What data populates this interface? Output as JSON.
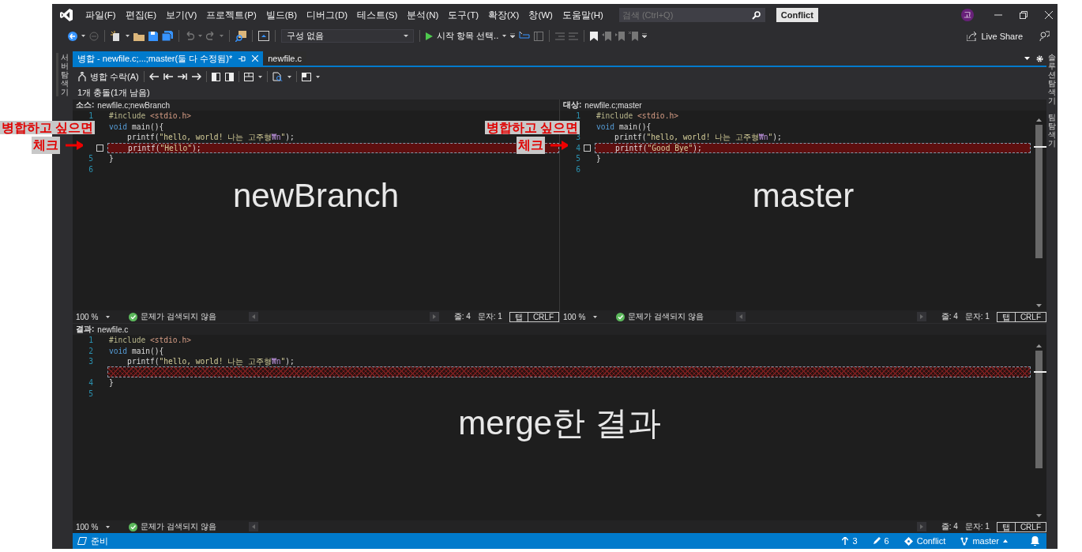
{
  "title_bar": {
    "menu": [
      "파일(F)",
      "편집(E)",
      "보기(V)",
      "프로젝트(P)",
      "빌드(B)",
      "디버그(D)",
      "테스트(S)",
      "분석(N)",
      "도구(T)",
      "확장(X)",
      "창(W)",
      "도움말(H)"
    ],
    "search": {
      "placeholder": "검색 (Ctrl+Q)"
    },
    "solution_badge": "Conflict",
    "avatar": "고"
  },
  "toolbar": {
    "configuration": "구성 없음",
    "start_item": "시작 항목 선택..",
    "live_share": "Live Share"
  },
  "side_tabs_left": [
    "서버 탐색기"
  ],
  "side_tabs_right": [
    "솔루션 탐색기",
    "팀 탐색기"
  ],
  "doc_tabs": [
    {
      "label": "병합 - newfile.c;...;master(둘 다 수정됨)*",
      "selected": true
    },
    {
      "label": "newfile.c",
      "selected": false
    }
  ],
  "merge_toolbar": {
    "accept": "병합 수락(A)"
  },
  "conflict_summary": "1개 충돌(1개 남음)",
  "panes": [
    {
      "label": "소스:",
      "file": "newfile.c;newBranch",
      "overlay_label": "newBranch",
      "scrollbar": false,
      "lines": [
        {
          "kind": "code",
          "number": "1",
          "tokens": [
            {
              "text": "#include ",
              "kind": "preproc"
            },
            {
              "text": "<stdio.h>",
              "kind": "header"
            }
          ]
        },
        {
          "kind": "code",
          "tokens": [
            {
              "text": "void",
              "kind": "keyword"
            },
            {
              "text": " main(){",
              "kind": "plain"
            }
          ]
        },
        {
          "kind": "code",
          "tokens": [
            {
              "text": "    printf(",
              "kind": "plain"
            },
            {
              "text": "\"hello, world! 나는 고주형",
              "kind": "string"
            },
            {
              "text": "₩n",
              "kind": "escape"
            },
            {
              "text": "\"",
              "kind": "string"
            },
            {
              "text": ");",
              "kind": "plain"
            }
          ]
        },
        {
          "kind": "conflict",
          "checked": false,
          "tokens": [
            {
              "text": "    printf(",
              "kind": "plain"
            },
            {
              "text": "\"Hello\"",
              "kind": "string"
            },
            {
              "text": ");",
              "kind": "plain"
            }
          ]
        },
        {
          "kind": "code",
          "number": "5",
          "tokens": [
            {
              "text": "}",
              "kind": "plain"
            }
          ]
        },
        {
          "kind": "code",
          "number": "6"
        }
      ],
      "status": {
        "zoom": "100 %",
        "issues": "문제가 검색되지 않음",
        "line": "줄: 4",
        "column": "문자: 1",
        "indent": "탭",
        "eol": "CRLF"
      }
    },
    {
      "label": "대상:",
      "file": "newfile.c;master",
      "overlay_label": "master",
      "scrollbar": true,
      "lines": [
        {
          "kind": "code",
          "number": "1",
          "tokens": [
            {
              "text": "#include ",
              "kind": "preproc"
            },
            {
              "text": "<stdio.h>",
              "kind": "header"
            }
          ]
        },
        {
          "kind": "code",
          "tokens": [
            {
              "text": "void",
              "kind": "keyword"
            },
            {
              "text": " main(){",
              "kind": "plain"
            }
          ]
        },
        {
          "kind": "code",
          "number": "3",
          "tokens": [
            {
              "text": "    printf(",
              "kind": "plain"
            },
            {
              "text": "\"hello, world! 나는 고주형",
              "kind": "string"
            },
            {
              "text": "₩n",
              "kind": "escape"
            },
            {
              "text": "\"",
              "kind": "string"
            },
            {
              "text": ");",
              "kind": "plain"
            }
          ]
        },
        {
          "kind": "conflict",
          "number": "4",
          "checked": false,
          "tokens": [
            {
              "text": "    printf(",
              "kind": "plain"
            },
            {
              "text": "\"Good Bye\"",
              "kind": "string"
            },
            {
              "text": ");",
              "kind": "plain"
            }
          ]
        },
        {
          "kind": "code",
          "number": "5",
          "tokens": [
            {
              "text": "}",
              "kind": "plain"
            }
          ]
        },
        {
          "kind": "code",
          "number": "6"
        }
      ],
      "status": {
        "zoom": "100 %",
        "issues": "문제가 검색되지 않음",
        "line": "줄: 4",
        "column": "문자: 1",
        "indent": "탭",
        "eol": "CRLF"
      }
    }
  ],
  "result": {
    "label": "결과:",
    "file": "newfile.c",
    "overlay_label": "merge한 결과",
    "scrollbar": true,
    "lines": [
      {
        "kind": "code",
        "number": "1",
        "tokens": [
          {
            "text": "#include ",
            "kind": "preproc"
          },
          {
            "text": "<stdio.h>",
            "kind": "header"
          }
        ]
      },
      {
        "kind": "code",
        "number": "2",
        "tokens": [
          {
            "text": "void",
            "kind": "keyword"
          },
          {
            "text": " main(){",
            "kind": "plain"
          }
        ]
      },
      {
        "kind": "code",
        "number": "3",
        "tokens": [
          {
            "text": "    printf(",
            "kind": "plain"
          },
          {
            "text": "\"hello, world! 나는 고주형",
            "kind": "string"
          },
          {
            "text": "₩n",
            "kind": "escape"
          },
          {
            "text": "\"",
            "kind": "string"
          },
          {
            "text": ");",
            "kind": "plain"
          }
        ]
      },
      {
        "kind": "placeholder"
      },
      {
        "kind": "code",
        "number": "4",
        "tokens": [
          {
            "text": "}",
            "kind": "plain"
          }
        ]
      },
      {
        "kind": "code",
        "number": "5"
      }
    ],
    "status": {
      "zoom": "100 %",
      "issues": "문제가 검색되지 않음",
      "line": "줄: 4",
      "column": "문자: 1",
      "indent": "탭",
      "eol": "CRLF"
    }
  },
  "callouts": [
    {
      "lines": [
        "병합하고 싶으면",
        "체크"
      ]
    },
    {
      "lines": [
        "병합하고 싶으면",
        "체크"
      ]
    }
  ],
  "status_bar": {
    "text": "준비",
    "outgoing": "3",
    "changes": "6",
    "repository": "Conflict",
    "branch": "master"
  }
}
